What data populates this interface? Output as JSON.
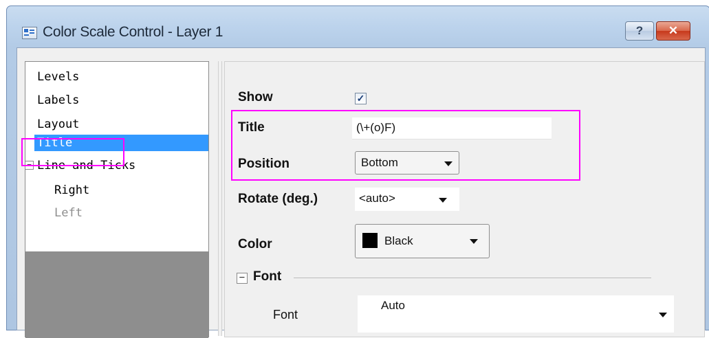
{
  "window": {
    "title": "Color Scale Control - Layer 1",
    "help_label": "?",
    "close_label": "✕"
  },
  "tree": {
    "items": [
      {
        "label": "Levels"
      },
      {
        "label": "Labels"
      },
      {
        "label": "Layout"
      },
      {
        "label": "Title",
        "selected": true
      },
      {
        "label": "Line and Ticks",
        "expanded": true,
        "toggle": "−"
      },
      {
        "label": "Right"
      },
      {
        "label": "Left",
        "disabled": true
      }
    ]
  },
  "props": {
    "show": {
      "label": "Show",
      "checked": true,
      "check_glyph": "✓"
    },
    "title": {
      "label": "Title",
      "value": "(\\+(o)F)"
    },
    "position": {
      "label": "Position",
      "value": "Bottom"
    },
    "rotate": {
      "label": "Rotate (deg.)",
      "value": "<auto>"
    },
    "color": {
      "label": "Color",
      "value": "Black",
      "swatch": "#000000"
    },
    "font_section": {
      "label": "Font",
      "toggle": "−"
    },
    "font": {
      "label": "Font",
      "value": "Auto"
    }
  },
  "colors": {
    "highlight": "#ff00ff",
    "selection": "#3399ff"
  }
}
